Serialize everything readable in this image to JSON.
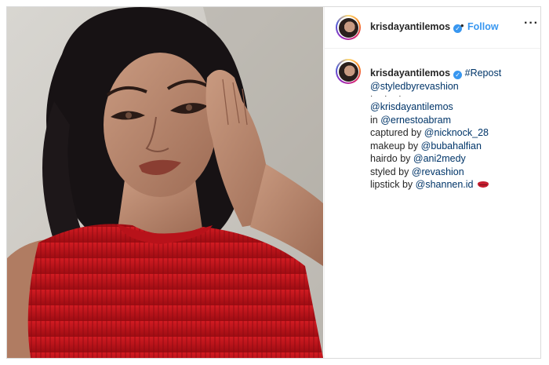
{
  "post": {
    "username": "krisdayantilemos",
    "verified_mark": "✓",
    "separator": "•",
    "follow_label": "Follow",
    "more_label": "···"
  },
  "caption": {
    "username": "krisdayantilemos",
    "repost_tag": "#Repost",
    "repost_mention": "@styledbyrevashion",
    "dots": "· · ·",
    "lines": [
      {
        "prefix": "",
        "mention": "@krisdayantilemos"
      },
      {
        "prefix": "in ",
        "mention": "@ernestoabram"
      },
      {
        "prefix": "captured by ",
        "mention": "@nicknock_28"
      },
      {
        "prefix": "makeup by ",
        "mention": "@bubahalfian"
      },
      {
        "prefix": "hairdo by ",
        "mention": "@ani2medy"
      },
      {
        "prefix": "styled by ",
        "mention": "@revashion"
      },
      {
        "prefix": "lipstick by ",
        "mention": "@shannen.id"
      }
    ],
    "emoji": "lips-emoji"
  },
  "colors": {
    "link": "#3897f0",
    "mention": "#003569",
    "dress": "#c8141c"
  }
}
